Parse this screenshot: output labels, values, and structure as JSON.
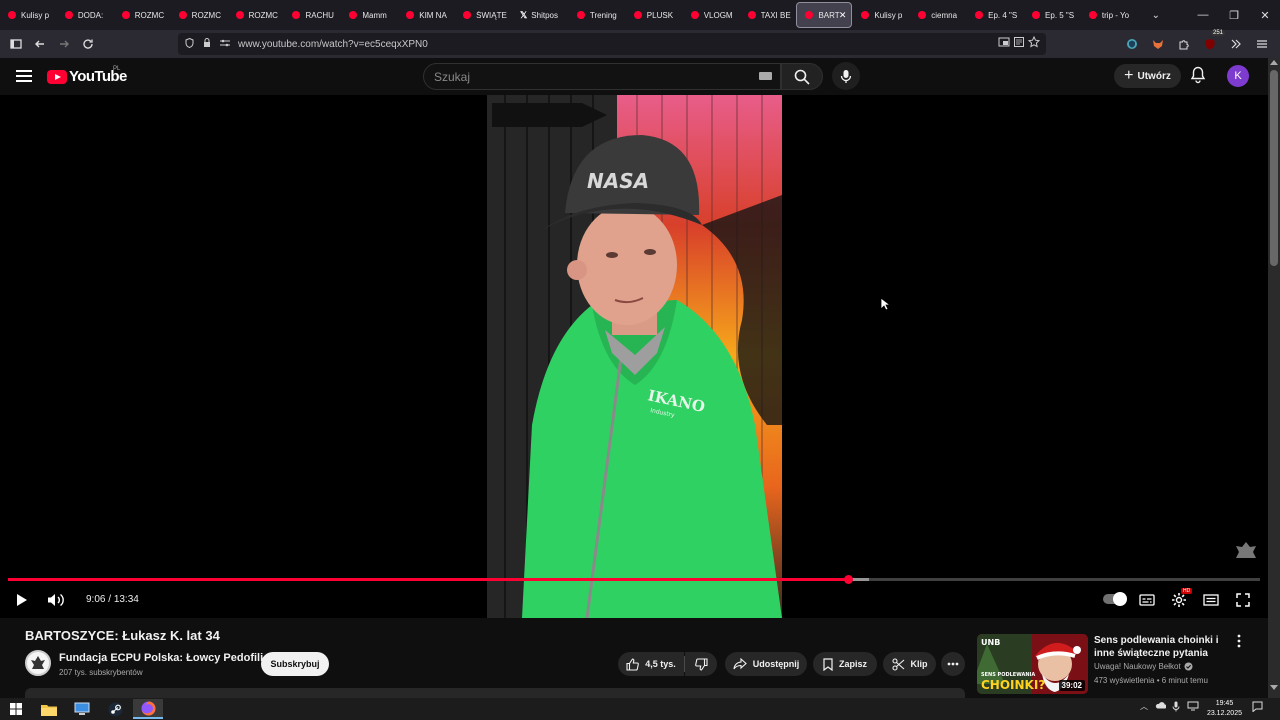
{
  "browser": {
    "tabs": [
      {
        "label": "Kulisy p",
        "icon": "youtube-icon"
      },
      {
        "label": "DODA:",
        "icon": "youtube-icon"
      },
      {
        "label": "ROZMC",
        "icon": "youtube-icon"
      },
      {
        "label": "ROZMC",
        "icon": "youtube-icon"
      },
      {
        "label": "ROZMC",
        "icon": "youtube-icon"
      },
      {
        "label": "RACHU",
        "icon": "youtube-icon"
      },
      {
        "label": "Mamm",
        "icon": "youtube-icon"
      },
      {
        "label": "KIM NA",
        "icon": "youtube-icon"
      },
      {
        "label": "ŚWIĄTE",
        "icon": "youtube-icon"
      },
      {
        "label": "Shitpos",
        "icon": "x-icon"
      },
      {
        "label": "Trening",
        "icon": "youtube-icon"
      },
      {
        "label": "PLUSK",
        "icon": "youtube-icon"
      },
      {
        "label": "VLOGM",
        "icon": "youtube-icon"
      },
      {
        "label": "TAXI BE",
        "icon": "youtube-icon"
      },
      {
        "label": "BART",
        "icon": "youtube-icon",
        "active": true
      },
      {
        "label": "Kulisy p",
        "icon": "youtube-icon"
      },
      {
        "label": "ciemna",
        "icon": "youtube-icon"
      },
      {
        "label": "Ep. 4 \"S",
        "icon": "youtube-icon"
      },
      {
        "label": "Ep. 5 \"S",
        "icon": "youtube-icon"
      },
      {
        "label": "trip - Yo",
        "icon": "youtube-icon"
      }
    ],
    "url": "www.youtube.com/watch?v=ec5ceqxXPN0",
    "extension_badge": "251"
  },
  "youtube": {
    "logo_text": "YouTube",
    "region": "PL",
    "search_placeholder": "Szukaj",
    "create_label": "Utwórz",
    "avatar_letter": "K"
  },
  "player": {
    "current_time": "9:06",
    "duration": "13:34",
    "played_fraction": 0.671,
    "buffered_fraction": 0.688,
    "settings_badge": "HD",
    "accent": "#ff0033"
  },
  "video": {
    "title": "BARTOSZYCE: Łukasz K. lat 34",
    "channel": "Fundacja ECPU Polska: Łowcy Pedofili",
    "subscribers": "207 tys. subskrybentów",
    "subscribe_label": "Subskrybuj",
    "likes": "4,5 tys.",
    "share_label": "Udostępnij",
    "save_label": "Zapisz",
    "clip_label": "Klip",
    "jacket_text_1": "IKANO",
    "jacket_text_2": "Industry"
  },
  "recommended": {
    "title": "Sens podlewania choinki i inne świąteczne pytania",
    "channel": "Uwaga! Naukowy Bełkot",
    "meta": "473 wyświetlenia • 6 minut temu",
    "duration": "39:02",
    "thumb_text_1": "SENS PODLEWANIA",
    "thumb_text_2": "CHOINKI?",
    "thumb_logo": "UNB"
  },
  "taskbar": {
    "time": "19:45",
    "date": "23.12.2025"
  }
}
